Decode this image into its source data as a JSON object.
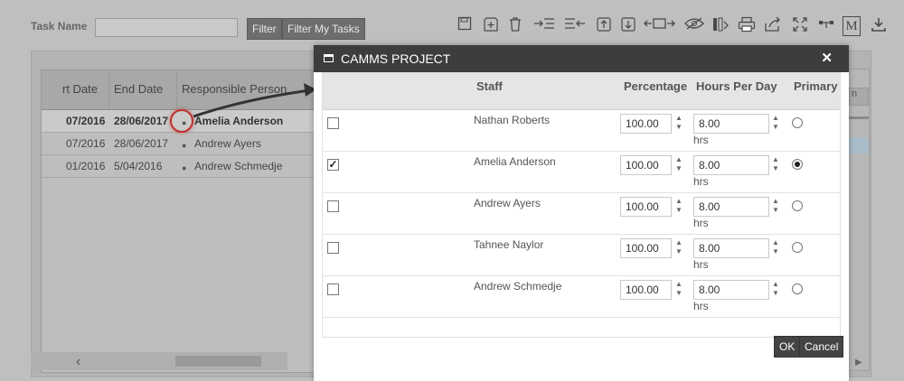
{
  "filter": {
    "task_name_label": "Task Name",
    "task_name_value": "",
    "filter_button": "Filter",
    "filter_my_tasks_button": "Filter My Tasks"
  },
  "toolbar": {
    "icons": [
      "save-icon",
      "add-icon",
      "delete-icon",
      "indent-icon",
      "outdent-icon",
      "move-up-icon",
      "move-down-icon",
      "expand-width-icon",
      "hide-icon",
      "columns-icon",
      "print-icon",
      "export-icon",
      "fullscreen-icon",
      "link-icon",
      "milestone-icon",
      "download-icon"
    ],
    "milestone_label": "M"
  },
  "grid": {
    "columns": [
      "rt Date",
      "End Date",
      "Responsible Person"
    ],
    "rows": [
      {
        "start": "07/2016",
        "end": "28/06/2017",
        "person": "Amelia Anderson"
      },
      {
        "start": "07/2016",
        "end": "28/06/2017",
        "person": "Andrew Ayers"
      },
      {
        "start": "01/2016",
        "end": "5/04/2016",
        "person": "Andrew Schmedje"
      }
    ],
    "right_header": "n"
  },
  "modal": {
    "title": "CAMMS PROJECT",
    "close_glyph": "✕",
    "columns": {
      "staff": "Staff",
      "percentage": "Percentage",
      "hours_per_day": "Hours Per Day",
      "primary": "Primary"
    },
    "hrs_unit": "hrs",
    "staff_rows": [
      {
        "name": "Nathan Roberts",
        "checked": false,
        "percentage": "100.00",
        "hours": "8.00",
        "primary": false
      },
      {
        "name": "Amelia Anderson",
        "checked": true,
        "percentage": "100.00",
        "hours": "8.00",
        "primary": true
      },
      {
        "name": "Andrew Ayers",
        "checked": false,
        "percentage": "100.00",
        "hours": "8.00",
        "primary": false
      },
      {
        "name": "Tahnee Naylor",
        "checked": false,
        "percentage": "100.00",
        "hours": "8.00",
        "primary": false
      },
      {
        "name": "Andrew Schmedje",
        "checked": false,
        "percentage": "100.00",
        "hours": "8.00",
        "primary": false
      }
    ],
    "ok_button": "OK",
    "cancel_button": "Cancel"
  },
  "colors": {
    "titlebar": "#3d3d3d",
    "annotation_ring": "#c0302b",
    "annotation_arrow": "#333333"
  }
}
